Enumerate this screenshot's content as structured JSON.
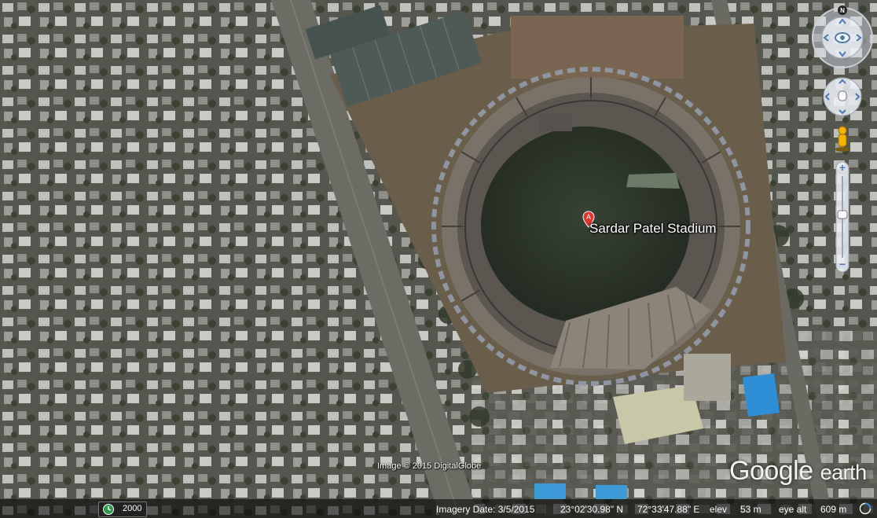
{
  "place": {
    "marker_letter": "A",
    "name": "Sardar Patel Stadium"
  },
  "attribution": {
    "copyright": "Image © 2015 DigitalGlobe"
  },
  "logo": {
    "brand": "Google",
    "product": "earth"
  },
  "status": {
    "historical_year": "2000",
    "imagery_date": "Imagery Date: 3/5/2015",
    "latitude": "23°02'30.98\" N",
    "longitude": "72°33'47.88\" E",
    "elev_label": "elev",
    "elevation": "53 m",
    "eye_alt_label": "eye alt",
    "eye_alt": "609 m"
  },
  "controls": {
    "north_label": "N",
    "zoom_in": "+",
    "zoom_out": "−",
    "icons": [
      "compass-icon",
      "look-joystick-icon",
      "move-joystick-icon",
      "pegman-icon",
      "zoom-slider",
      "clock-icon",
      "globe-icon"
    ]
  },
  "colors": {
    "stadium_field": "#2f3a2c",
    "water": "#2f8fd6",
    "marker": "#e0342b",
    "statusbar": "#000000"
  }
}
